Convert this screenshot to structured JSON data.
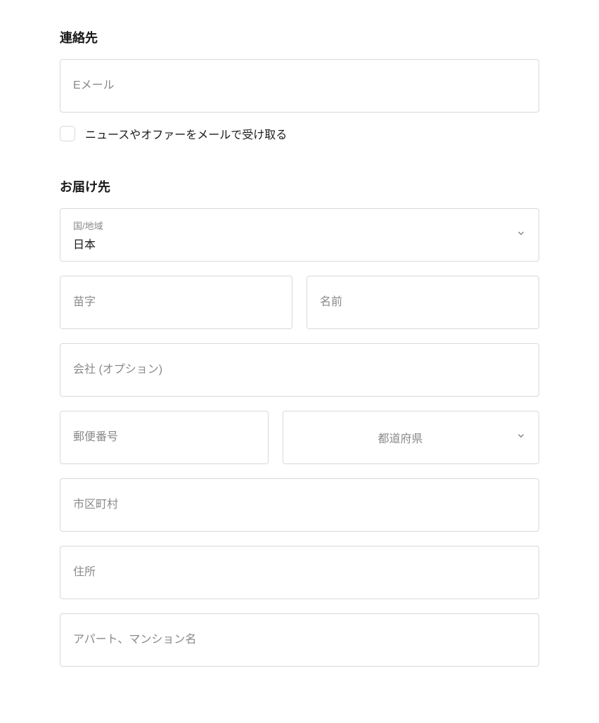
{
  "contact": {
    "title": "連絡先",
    "email_placeholder": "Eメール",
    "newsletter_label": "ニュースやオファーをメールで受け取る"
  },
  "delivery": {
    "title": "お届け先",
    "country_label": "国/地域",
    "country_value": "日本",
    "last_name_placeholder": "苗字",
    "first_name_placeholder": "名前",
    "company_placeholder": "会社 (オプション)",
    "postal_code_placeholder": "郵便番号",
    "prefecture_placeholder": "都道府県",
    "city_placeholder": "市区町村",
    "address_placeholder": "住所",
    "apartment_placeholder": "アパート、マンション名"
  }
}
